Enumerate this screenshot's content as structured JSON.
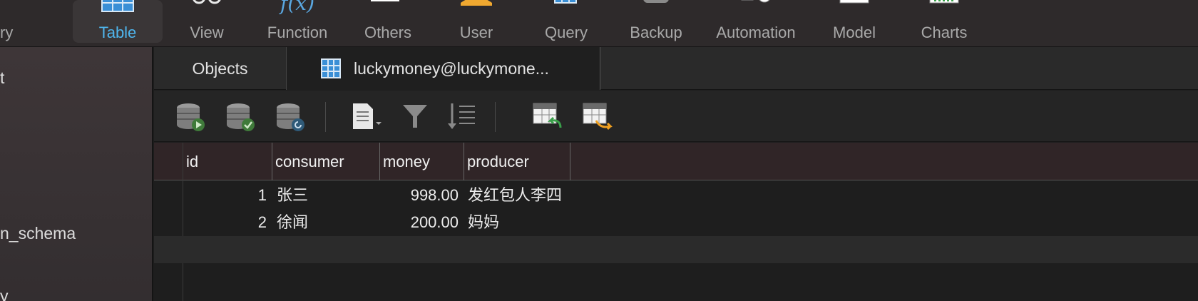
{
  "toolbar": {
    "items": [
      {
        "label": "ry",
        "icon": "query-icon"
      },
      {
        "label": "Table",
        "icon": "table-icon",
        "active": true
      },
      {
        "label": "View",
        "icon": "view-icon"
      },
      {
        "label": "Function",
        "icon": "function-icon",
        "glyph": "f(x)"
      },
      {
        "label": "Others",
        "icon": "others-icon"
      },
      {
        "label": "User",
        "icon": "user-icon"
      },
      {
        "label": "Query",
        "icon": "query-icon"
      },
      {
        "label": "Backup",
        "icon": "backup-icon"
      },
      {
        "label": "Automation",
        "icon": "automation-icon"
      },
      {
        "label": "Model",
        "icon": "model-icon"
      },
      {
        "label": "Charts",
        "icon": "charts-icon"
      }
    ]
  },
  "sidebar": {
    "items": [
      {
        "label": "t"
      },
      {
        "label": "n_schema"
      },
      {
        "label": "y"
      }
    ]
  },
  "tabs": {
    "objects": "Objects",
    "table": "luckymoney@luckymone..."
  },
  "subtoolbar": {
    "buttons": [
      "begin-transaction-icon",
      "commit-icon",
      "rollback-icon",
      "text-icon",
      "filter-icon",
      "sort-icon",
      "import-icon",
      "export-icon"
    ]
  },
  "grid": {
    "columns": [
      "id",
      "consumer",
      "money",
      "producer"
    ],
    "rows": [
      {
        "id": "1",
        "consumer": "张三",
        "money": "998.00",
        "producer": "发红包人李四"
      },
      {
        "id": "2",
        "consumer": "徐闻",
        "money": "200.00",
        "producer": "妈妈"
      }
    ]
  },
  "colors": {
    "accent": "#4fb6ee",
    "toolbar_bg": "#2e2a2b",
    "header_bg": "#302527"
  }
}
